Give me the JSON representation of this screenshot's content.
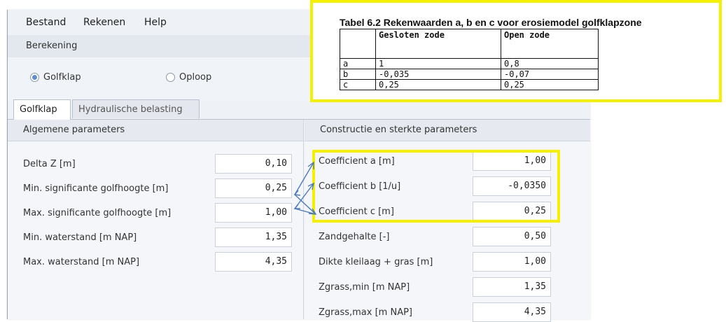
{
  "menu": [
    "Bestand",
    "Rekenen",
    "Help"
  ],
  "section_title": "Berekening",
  "radio": {
    "golfklap": {
      "label": "Golfklap",
      "selected": true
    },
    "oploop": {
      "label": "Oploop",
      "selected": false
    }
  },
  "tabs": [
    {
      "label": "Golfklap",
      "active": true
    },
    {
      "label": "Hydraulische belasting",
      "active": false
    }
  ],
  "left_panel": {
    "title": "Algemene parameters",
    "rows": [
      {
        "label": "Delta Z [m]",
        "value": "0,10"
      },
      {
        "label": "Min. significante golfhoogte [m]",
        "value": "0,25"
      },
      {
        "label": "Max. significante golfhoogte [m]",
        "value": "1,00"
      },
      {
        "label": "Min. waterstand [m NAP]",
        "value": "1,35"
      },
      {
        "label": "Max. waterstand [m NAP]",
        "value": "4,35"
      }
    ]
  },
  "right_panel": {
    "title": "Constructie en sterkte parameters",
    "rows": [
      {
        "label": "Coefficient a [m]",
        "value": "1,00"
      },
      {
        "label": "Coefficient b [1/u]",
        "value": "-0,0350"
      },
      {
        "label": "Coefficient c [m]",
        "value": "0,25"
      },
      {
        "label": "Zandgehalte [-]",
        "value": "0,50"
      },
      {
        "label": "Dikte kleilaag + gras [m]",
        "value": "1,00"
      },
      {
        "label": "Zgrass,min [m NAP]",
        "value": "1,35"
      },
      {
        "label": "Zgrass,max [m NAP]",
        "value": "4,35"
      }
    ]
  },
  "doc_table": {
    "caption": "Tabel 6.2    Rekenwaarden a, b en c voor erosiemodel golfklapzone",
    "headers": [
      "",
      "Gesloten zode",
      "Open zode"
    ],
    "rows": [
      [
        "a",
        "1",
        "0,8"
      ],
      [
        "b",
        "-0,035",
        "-0,07"
      ],
      [
        "c",
        "0,25",
        "0,25"
      ]
    ]
  },
  "colors": {
    "highlight": "#f4f000",
    "arrow": "#4a78c2",
    "radio_selected": "#5c8fd3"
  }
}
